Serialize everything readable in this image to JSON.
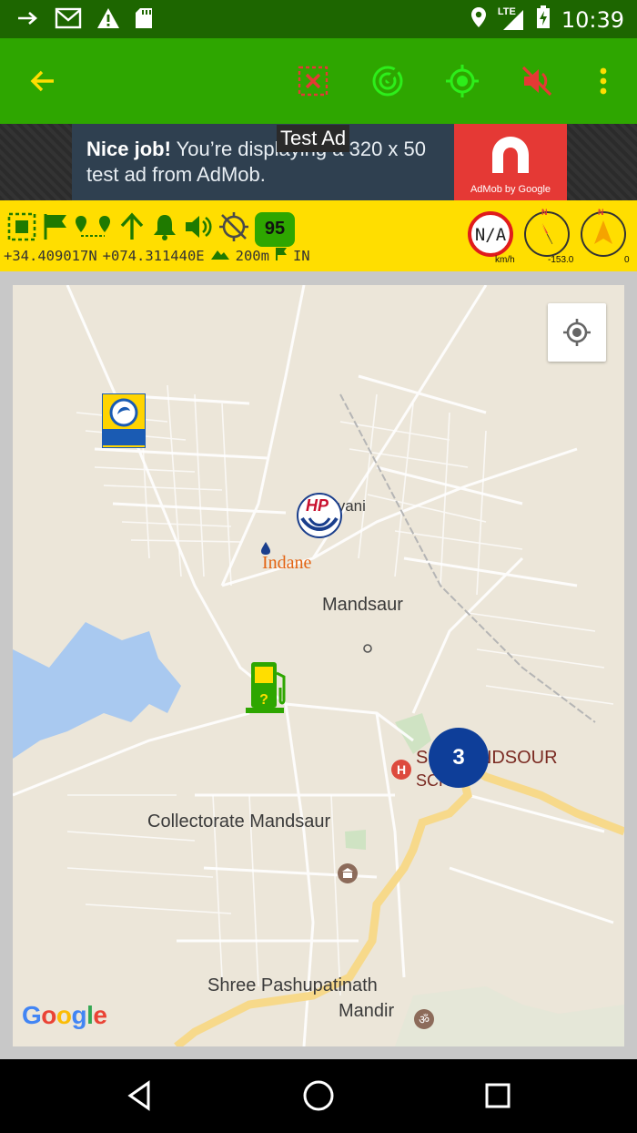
{
  "status_bar": {
    "time": "10:39",
    "network": "LTE",
    "icons": [
      "arrow-right-icon",
      "gmail-icon",
      "warning-icon",
      "sd-card-icon",
      "location-icon",
      "signal-icon",
      "battery-icon"
    ]
  },
  "toolbar": {
    "icons": [
      "back-arrow-icon",
      "area-close-icon",
      "radar-icon",
      "gps-target-icon",
      "sound-off-icon",
      "overflow-menu-icon"
    ],
    "colors": {
      "background": "#2ea600",
      "accent": "#ffde00"
    }
  },
  "ad": {
    "headline": "Nice job!",
    "body": "You’re displaying a 320 x 50 test ad from AdMob.",
    "brand": "AdMob by Google",
    "overlay": "Test Ad"
  },
  "info_bar": {
    "speed_limit": "95",
    "speed_value": "N/A",
    "speed_unit": "km/h",
    "heading_value": "-153.0",
    "bearing_value": "0",
    "north_marker": "N",
    "latitude": "+34.409017N",
    "longitude": "+074.311440E",
    "range": "200m",
    "country": "IN"
  },
  "map": {
    "labels": {
      "tyani": "tyani",
      "mandsaur": "Mandsaur",
      "school": "S  H MANDSOUR",
      "school2": "SCH  H",
      "collectorate": "Collectorate Mandsaur",
      "pashupatinath": "Shree Pashupatinath",
      "mandir": "Mandir"
    },
    "cluster_count": "3",
    "google": "Google",
    "logos": {
      "bharat": "Bharat Petroleum",
      "hp": "HP",
      "indane": "Indane"
    }
  }
}
